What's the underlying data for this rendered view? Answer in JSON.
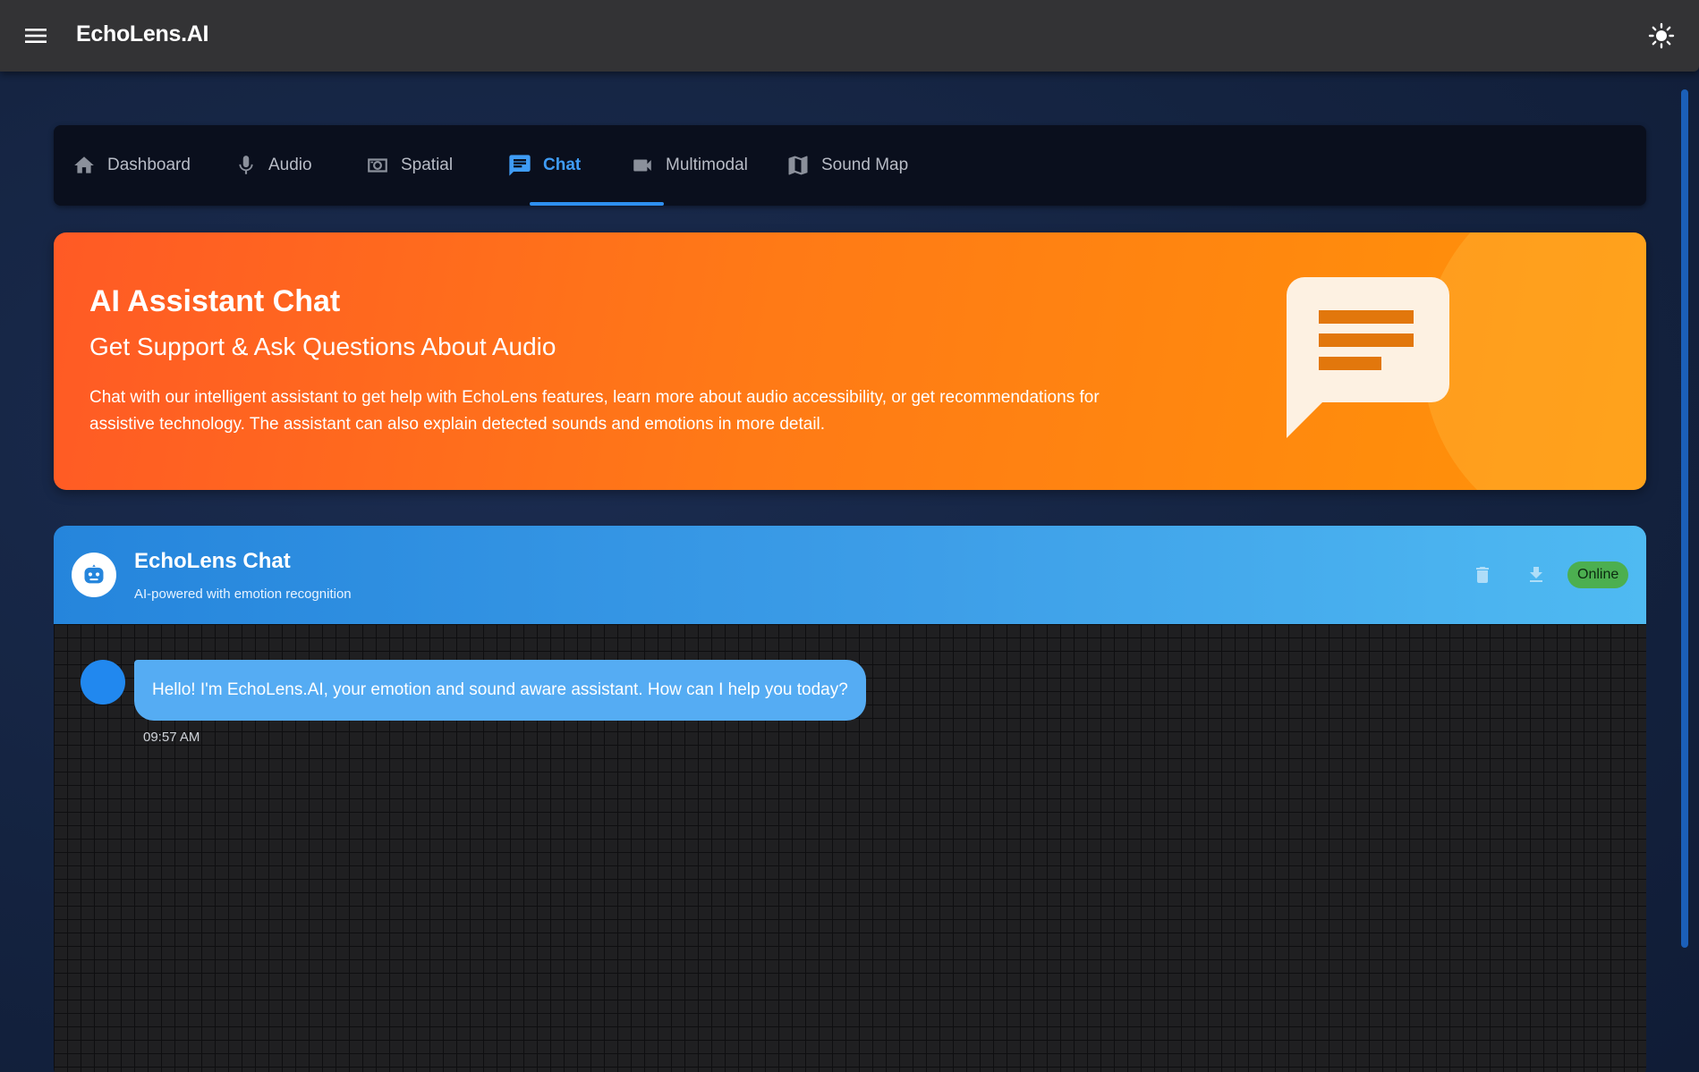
{
  "app": {
    "title": "EchoLens.AI"
  },
  "tabs": [
    {
      "label": "Dashboard",
      "icon": "home-icon"
    },
    {
      "label": "Audio",
      "icon": "mic-icon"
    },
    {
      "label": "Spatial",
      "icon": "camera-icon"
    },
    {
      "label": "Chat",
      "icon": "chat-icon",
      "active": true
    },
    {
      "label": "Multimodal",
      "icon": "videocam-icon"
    },
    {
      "label": "Sound Map",
      "icon": "map-icon"
    }
  ],
  "hero": {
    "title": "AI Assistant Chat",
    "subtitle": "Get Support & Ask Questions About Audio",
    "description": "Chat with our intelligent assistant to get help with EchoLens features, learn more about audio accessibility, or get recommendations for assistive technology. The assistant can also explain detected sounds and emotions in more detail."
  },
  "chat": {
    "title": "EchoLens Chat",
    "subtitle": "AI-powered with emotion recognition",
    "status": "Online",
    "messages": [
      {
        "text": "Hello! I'm EchoLens.AI, your emotion and sound aware assistant. How can I help you today?",
        "time": "09:57 AM"
      }
    ]
  },
  "colors": {
    "accent": "#2e8ff0",
    "hero_start": "#ff5a25",
    "hero_end": "#ff9408",
    "status_online": "#4caf50"
  }
}
